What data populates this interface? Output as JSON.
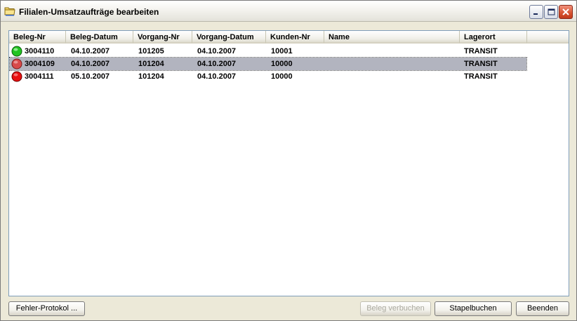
{
  "window": {
    "title": "Filialen-Umsatzaufträge bearbeiten",
    "icon": "folder-icon"
  },
  "columns": [
    {
      "key": "beleg_nr",
      "label": "Beleg-Nr"
    },
    {
      "key": "beleg_datum",
      "label": "Beleg-Datum"
    },
    {
      "key": "vorgang_nr",
      "label": "Vorgang-Nr"
    },
    {
      "key": "vorgang_datum",
      "label": "Vorgang-Datum"
    },
    {
      "key": "kunden_nr",
      "label": "Kunden-Nr"
    },
    {
      "key": "name",
      "label": "Name"
    },
    {
      "key": "lagerort",
      "label": "Lagerort"
    }
  ],
  "rows": [
    {
      "status": "green",
      "status_color": "#22c422",
      "beleg_nr": "3004110",
      "beleg_datum": "04.10.2007",
      "vorgang_nr": "101205",
      "vorgang_datum": "04.10.2007",
      "kunden_nr": "10001",
      "name": "",
      "lagerort": "TRANSIT",
      "selected": false
    },
    {
      "status": "red",
      "status_color": "#d84a4a",
      "beleg_nr": "3004109",
      "beleg_datum": "04.10.2007",
      "vorgang_nr": "101204",
      "vorgang_datum": "04.10.2007",
      "kunden_nr": "10000",
      "name": "",
      "lagerort": "TRANSIT",
      "selected": true
    },
    {
      "status": "red",
      "status_color": "#e81010",
      "beleg_nr": "3004111",
      "beleg_datum": "05.10.2007",
      "vorgang_nr": "101204",
      "vorgang_datum": "04.10.2007",
      "kunden_nr": "10000",
      "name": "",
      "lagerort": "TRANSIT",
      "selected": false
    }
  ],
  "buttons": {
    "fehler_protokol": "Fehler-Protokol ...",
    "beleg_verbuchen": "Beleg verbuchen",
    "stapelbuchen": "Stapelbuchen",
    "beenden": "Beenden"
  },
  "colors": {
    "selection": "#b2b4bf",
    "status_green": "#22c422",
    "status_red": "#e81010"
  }
}
